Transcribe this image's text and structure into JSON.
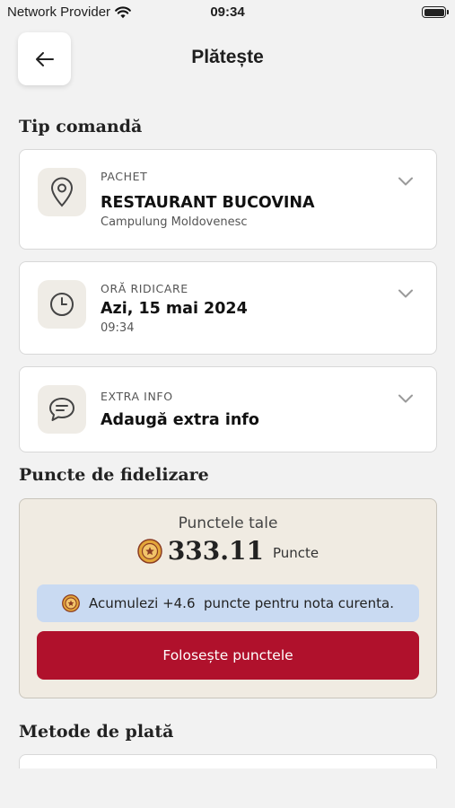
{
  "status_bar": {
    "carrier": "Network Provider",
    "time": "09:34",
    "wifi_icon": "wifi-icon",
    "battery_icon": "battery-icon"
  },
  "header": {
    "title": "Plătește",
    "back_icon": "arrow-left-icon"
  },
  "order_type": {
    "section_title": "Tip comandă",
    "cards": [
      {
        "kicker": "PACHET",
        "main": "RESTAURANT BUCOVINA",
        "sub": "Campulung Moldovenesc",
        "icon": "location-pin-icon"
      },
      {
        "kicker": "ORĂ RIDICARE",
        "main": "Azi, 15 mai 2024",
        "sub": "09:34",
        "icon": "clock-icon"
      },
      {
        "kicker": "EXTRA INFO",
        "main": "Adaugă extra info",
        "icon": "chat-bubble-icon"
      }
    ]
  },
  "loyalty": {
    "section_title": "Puncte de fidelizare",
    "label": "Punctele tale",
    "value": "333.11",
    "unit": "Puncte",
    "info": "Acumulezi +4.6  puncte pentru nota curenta.",
    "button": "Folosește punctele",
    "coin_icon": "coin-icon",
    "colors": {
      "button": "#b0112c",
      "info_bg": "#c9daf2",
      "card_bg": "#f0ebe2",
      "coin": "#e3a63a"
    }
  },
  "payment": {
    "section_title": "Metode de plată"
  }
}
